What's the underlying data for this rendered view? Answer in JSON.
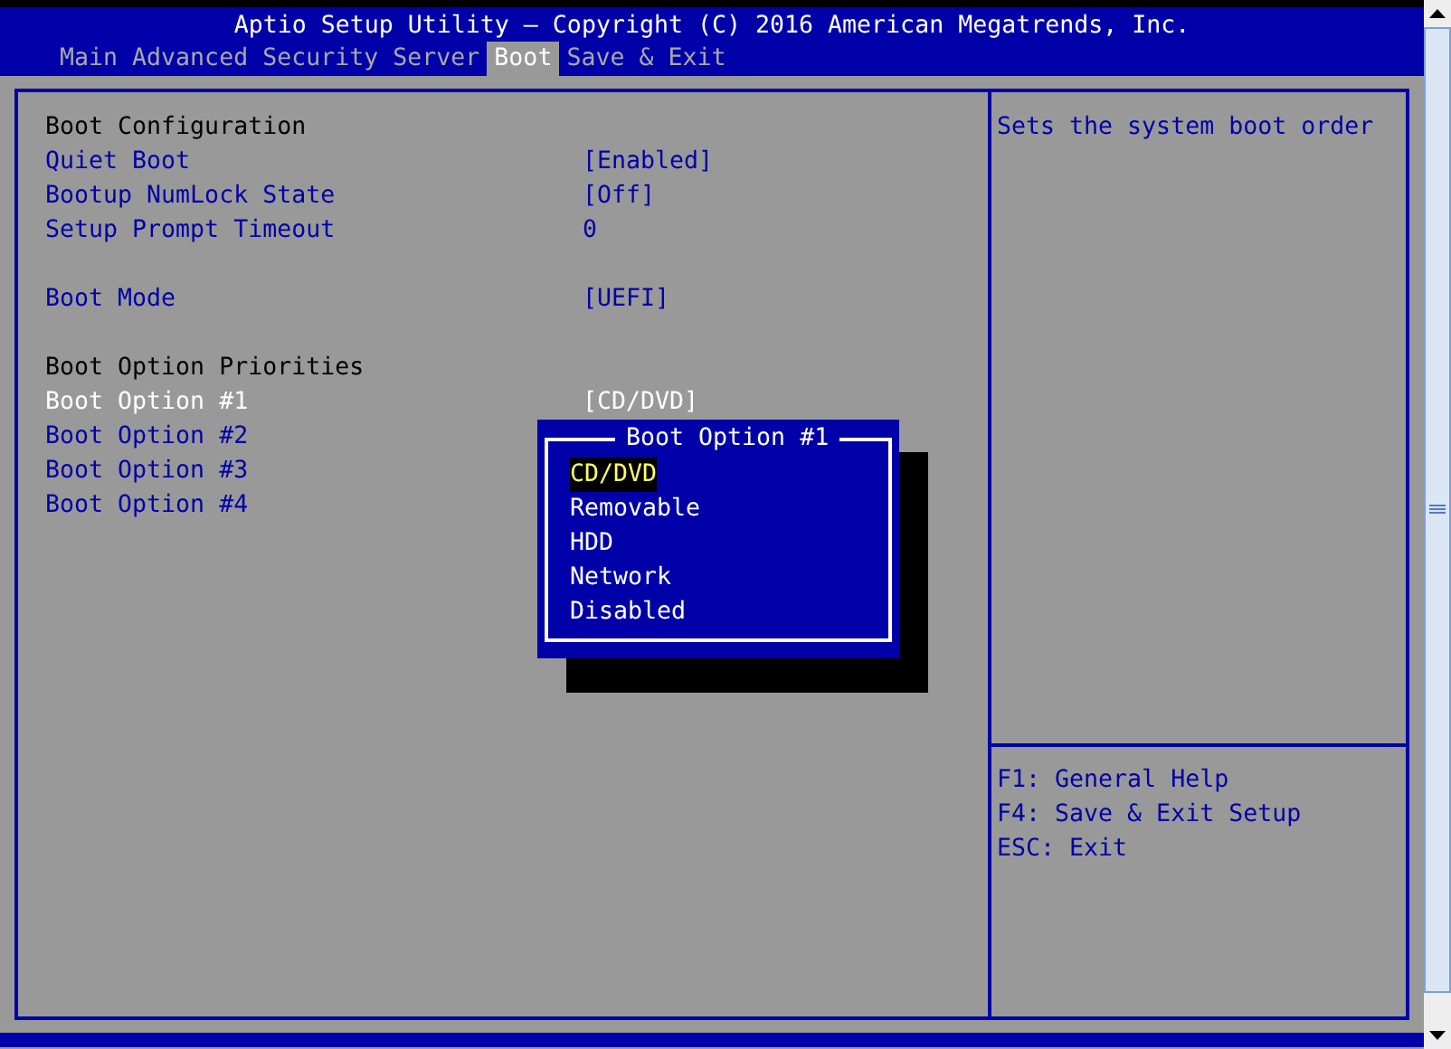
{
  "window": {
    "title": "Aptio Setup Utility – Copyright (C) 2016 American Megatrends, Inc."
  },
  "tabs": [
    {
      "label": "Main",
      "selected": false
    },
    {
      "label": "Advanced",
      "selected": false
    },
    {
      "label": "Security",
      "selected": false
    },
    {
      "label": "Server",
      "selected": false
    },
    {
      "label": "Boot",
      "selected": true
    },
    {
      "label": "Save & Exit",
      "selected": false
    }
  ],
  "settings": [
    {
      "heading": "Boot Configuration",
      "rows": [
        {
          "label": "Quiet Boot",
          "value": "[Enabled]",
          "selected": false
        },
        {
          "label": "Bootup NumLock State",
          "value": "[Off]",
          "selected": false
        },
        {
          "label": "Setup Prompt Timeout",
          "value": "0",
          "selected": false
        }
      ]
    },
    {
      "rows": [
        {
          "label": "Boot Mode",
          "value": "[UEFI]",
          "selected": false
        }
      ]
    },
    {
      "heading": "Boot Option Priorities",
      "rows": [
        {
          "label": "Boot Option #1",
          "value": "[CD/DVD]",
          "selected": true
        },
        {
          "label": "Boot Option #2",
          "selected": false
        },
        {
          "label": "Boot Option #3",
          "selected": false
        },
        {
          "label": "Boot Option #4",
          "selected": false
        }
      ]
    }
  ],
  "popup": {
    "title": "Boot Option #1",
    "options": [
      {
        "label": "CD/DVD",
        "selected": true
      },
      {
        "label": "Removable",
        "selected": false
      },
      {
        "label": "HDD",
        "selected": false
      },
      {
        "label": "Network",
        "selected": false
      },
      {
        "label": "Disabled",
        "selected": false
      }
    ]
  },
  "help": {
    "text": "Sets the system boot order",
    "keys": [
      "F1: General Help",
      "F4: Save & Exit Setup",
      "ESC: Exit"
    ]
  }
}
